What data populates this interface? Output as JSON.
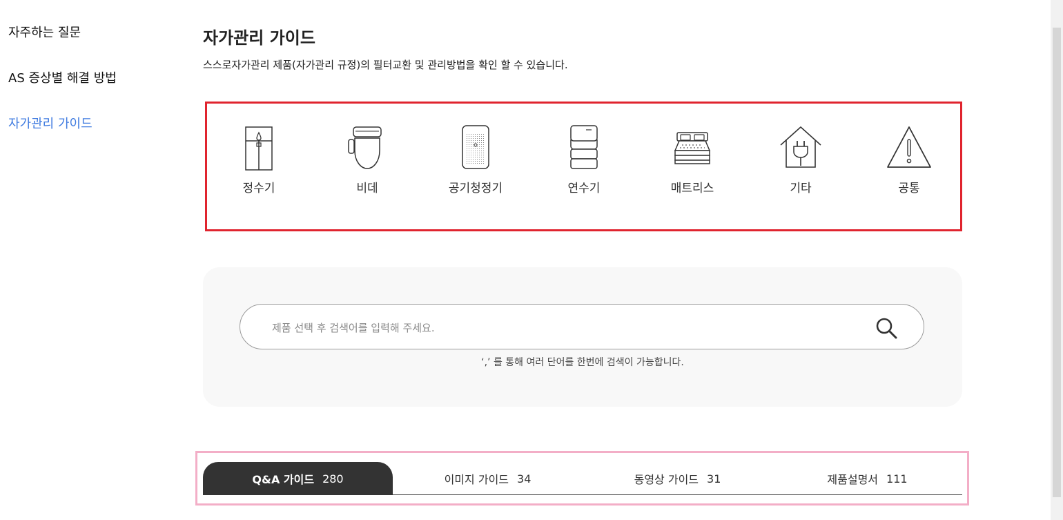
{
  "sidebar": {
    "items": [
      {
        "label": "자주하는 질문",
        "active": false
      },
      {
        "label": "AS 증상별 해결 방법",
        "active": false
      },
      {
        "label": "자가관리 가이드",
        "active": true
      }
    ]
  },
  "header": {
    "title": "자가관리 가이드",
    "description": "스스로자가관리 제품(자가관리 규정)의 필터교환 및 관리방법을 확인 할 수 있습니다."
  },
  "categories": [
    {
      "label": "정수기",
      "icon": "water-purifier-icon"
    },
    {
      "label": "비데",
      "icon": "bidet-icon"
    },
    {
      "label": "공기청정기",
      "icon": "air-purifier-icon"
    },
    {
      "label": "연수기",
      "icon": "water-softener-icon"
    },
    {
      "label": "매트리스",
      "icon": "mattress-icon"
    },
    {
      "label": "기타",
      "icon": "house-plug-icon"
    },
    {
      "label": "공통",
      "icon": "warning-icon"
    }
  ],
  "search": {
    "placeholder": "제품 선택 후 검색어를 입력해 주세요.",
    "value": "",
    "hint": "‘,’ 를 통해 여러 단어를 한번에 검색이 가능합니다.",
    "icon": "search-icon"
  },
  "tabs": [
    {
      "label": "Q&A 가이드",
      "count": "280",
      "active": true
    },
    {
      "label": "이미지 가이드",
      "count": "34",
      "active": false
    },
    {
      "label": "동영상 가이드",
      "count": "31",
      "active": false
    },
    {
      "label": "제품설명서",
      "count": "111",
      "active": false
    }
  ],
  "colors": {
    "accent": "#3f7be0",
    "highlight_box": "#e0242e",
    "tabs_highlight": "#f3aec7",
    "active_tab": "#333333",
    "panel_bg": "#f8f8f8"
  }
}
